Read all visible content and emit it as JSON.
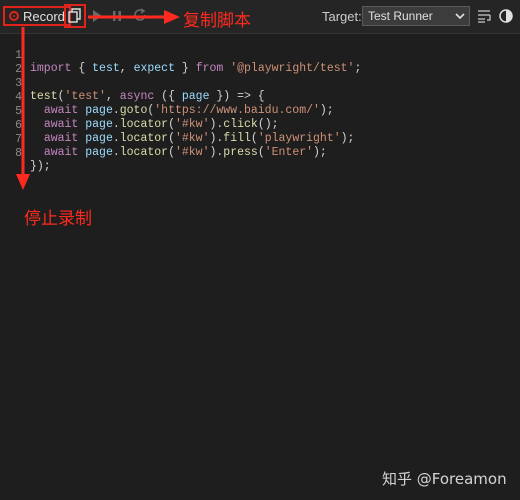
{
  "toolbar": {
    "record_label": "Record",
    "target_label": "Target:",
    "target_value": "Test Runner",
    "icons": {
      "record": "record-icon",
      "copy": "copy-icon",
      "play": "play-icon",
      "pause": "pause-icon",
      "refresh": "refresh-icon",
      "wrap": "wrap-lines-icon",
      "theme": "theme-toggle-icon",
      "caret": "chevron-down-icon"
    }
  },
  "editor": {
    "lines": [
      {
        "n": "1",
        "tokens": [
          [
            "kw",
            "import"
          ],
          [
            "plain",
            " { "
          ],
          [
            "var",
            "test"
          ],
          [
            "plain",
            ", "
          ],
          [
            "var",
            "expect"
          ],
          [
            "plain",
            " } "
          ],
          [
            "kw",
            "from"
          ],
          [
            "plain",
            " "
          ],
          [
            "str",
            "'@playwright/test'"
          ],
          [
            "plain",
            ";"
          ]
        ]
      },
      {
        "n": "2",
        "tokens": []
      },
      {
        "n": "3",
        "tokens": [
          [
            "fn",
            "test"
          ],
          [
            "plain",
            "("
          ],
          [
            "str",
            "'test'"
          ],
          [
            "plain",
            ", "
          ],
          [
            "kw",
            "async"
          ],
          [
            "plain",
            " ({ "
          ],
          [
            "var",
            "page"
          ],
          [
            "plain",
            " }) => {"
          ]
        ]
      },
      {
        "n": "4",
        "tokens": [
          [
            "plain",
            "  "
          ],
          [
            "kw",
            "await"
          ],
          [
            "plain",
            " "
          ],
          [
            "var",
            "page"
          ],
          [
            "plain",
            "."
          ],
          [
            "fn",
            "goto"
          ],
          [
            "plain",
            "("
          ],
          [
            "str",
            "'https://www.baidu.com/'"
          ],
          [
            "plain",
            ");"
          ]
        ]
      },
      {
        "n": "5",
        "tokens": [
          [
            "plain",
            "  "
          ],
          [
            "kw",
            "await"
          ],
          [
            "plain",
            " "
          ],
          [
            "var",
            "page"
          ],
          [
            "plain",
            "."
          ],
          [
            "fn",
            "locator"
          ],
          [
            "plain",
            "("
          ],
          [
            "str",
            "'#kw'"
          ],
          [
            "plain",
            ")."
          ],
          [
            "fn",
            "click"
          ],
          [
            "plain",
            "();"
          ]
        ]
      },
      {
        "n": "6",
        "tokens": [
          [
            "plain",
            "  "
          ],
          [
            "kw",
            "await"
          ],
          [
            "plain",
            " "
          ],
          [
            "var",
            "page"
          ],
          [
            "plain",
            "."
          ],
          [
            "fn",
            "locator"
          ],
          [
            "plain",
            "("
          ],
          [
            "str",
            "'#kw'"
          ],
          [
            "plain",
            ")."
          ],
          [
            "fn",
            "fill"
          ],
          [
            "plain",
            "("
          ],
          [
            "str",
            "'playwright'"
          ],
          [
            "plain",
            ");"
          ]
        ]
      },
      {
        "n": "7",
        "tokens": [
          [
            "plain",
            "  "
          ],
          [
            "kw",
            "await"
          ],
          [
            "plain",
            " "
          ],
          [
            "var",
            "page"
          ],
          [
            "plain",
            "."
          ],
          [
            "fn",
            "locator"
          ],
          [
            "plain",
            "("
          ],
          [
            "str",
            "'#kw'"
          ],
          [
            "plain",
            ")."
          ],
          [
            "fn",
            "press"
          ],
          [
            "plain",
            "("
          ],
          [
            "str",
            "'Enter'"
          ],
          [
            "plain",
            ");"
          ]
        ]
      },
      {
        "n": "8",
        "tokens": [
          [
            "plain",
            "});"
          ]
        ]
      }
    ]
  },
  "annotations": {
    "copy_script": "复制脚本",
    "stop_recording": "停止录制"
  },
  "watermark": "知乎 @Foreamon",
  "colors": {
    "annotation": "#ff2a1f",
    "background": "#1e1e1e",
    "toolbar": "#252526"
  }
}
